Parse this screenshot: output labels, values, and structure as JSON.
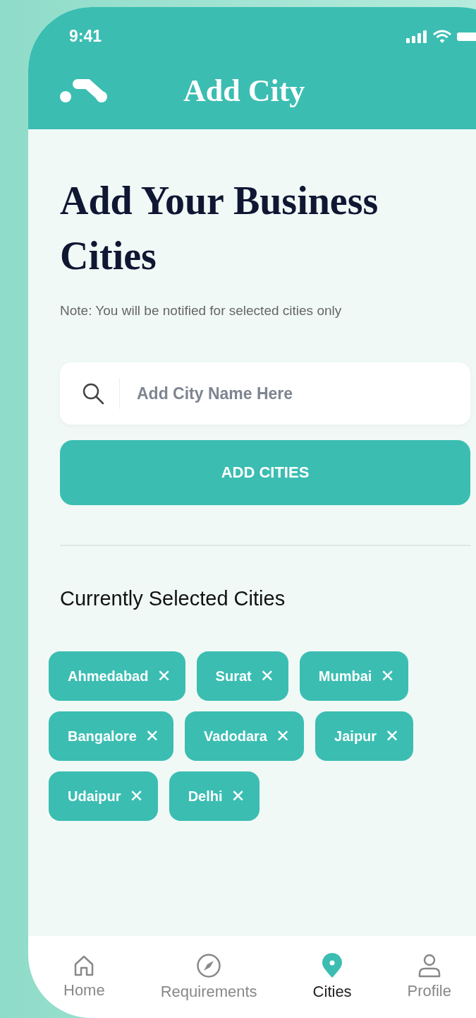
{
  "status_bar": {
    "time": "9:41"
  },
  "header": {
    "title": "Add City"
  },
  "heading": "Add Your Business Cities",
  "note": "Note: You will be notified for selected cities only",
  "search": {
    "placeholder": "Add City Name Here"
  },
  "add_button": "ADD CITIES",
  "section_title": "Currently Selected Cities",
  "chips": [
    {
      "label": "Ahmedabad",
      "remove": "✕"
    },
    {
      "label": "Surat",
      "remove": "✕"
    },
    {
      "label": "Mumbai",
      "remove": "✕"
    },
    {
      "label": "Bangalore",
      "remove": "✕"
    },
    {
      "label": "Vadodara",
      "remove": "✕"
    },
    {
      "label": "Jaipur",
      "remove": "✕"
    },
    {
      "label": "Udaipur",
      "remove": "✕"
    },
    {
      "label": "Delhi",
      "remove": "✕"
    }
  ],
  "tabs": [
    {
      "label": "Home",
      "kind": "home",
      "selected": false
    },
    {
      "label": "Requirements",
      "kind": "compass",
      "selected": false
    },
    {
      "label": "Cities",
      "kind": "pin",
      "selected": true
    },
    {
      "label": "Profile",
      "kind": "person",
      "selected": false
    }
  ]
}
